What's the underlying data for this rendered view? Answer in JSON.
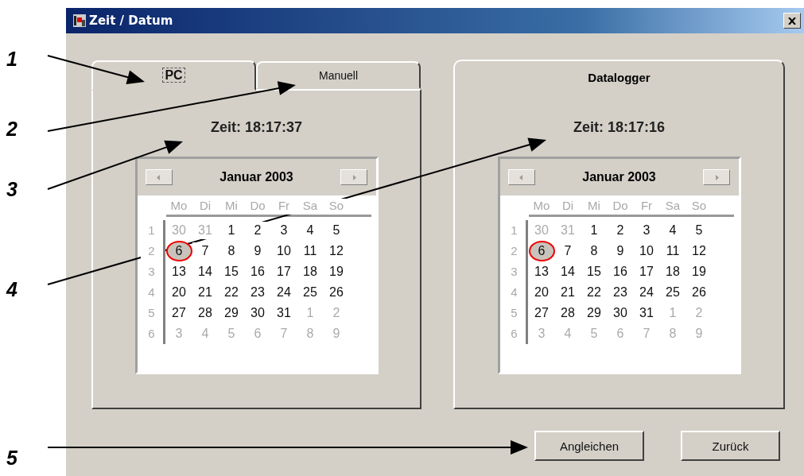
{
  "window": {
    "title": "Zeit / Datum"
  },
  "callouts": [
    {
      "number": "1"
    },
    {
      "number": "2"
    },
    {
      "number": "3"
    },
    {
      "number": "4"
    },
    {
      "number": "5"
    }
  ],
  "tabs": [
    {
      "label": "PC",
      "selected": true
    },
    {
      "label": "Manuell",
      "selected": false
    }
  ],
  "panels": [
    {
      "kind": "tabbed",
      "time": "Zeit: 18:17:37",
      "calendar": {
        "month": "Januar 2003",
        "weekdays": [
          "Mo",
          "Di",
          "Mi",
          "Do",
          "Fr",
          "Sa",
          "So"
        ],
        "weeks": [
          {
            "number": "1",
            "days": [
              {
                "day": "30",
                "muted": true,
                "selected": false
              },
              {
                "day": "31",
                "muted": true,
                "selected": false
              },
              {
                "day": "1",
                "muted": false,
                "selected": false
              },
              {
                "day": "2",
                "muted": false,
                "selected": false
              },
              {
                "day": "3",
                "muted": false,
                "selected": false
              },
              {
                "day": "4",
                "muted": false,
                "selected": false
              },
              {
                "day": "5",
                "muted": false,
                "selected": false
              }
            ]
          },
          {
            "number": "2",
            "days": [
              {
                "day": "6",
                "muted": false,
                "selected": true
              },
              {
                "day": "7",
                "muted": false,
                "selected": false
              },
              {
                "day": "8",
                "muted": false,
                "selected": false
              },
              {
                "day": "9",
                "muted": false,
                "selected": false
              },
              {
                "day": "10",
                "muted": false,
                "selected": false
              },
              {
                "day": "11",
                "muted": false,
                "selected": false
              },
              {
                "day": "12",
                "muted": false,
                "selected": false
              }
            ]
          },
          {
            "number": "3",
            "days": [
              {
                "day": "13",
                "muted": false,
                "selected": false
              },
              {
                "day": "14",
                "muted": false,
                "selected": false
              },
              {
                "day": "15",
                "muted": false,
                "selected": false
              },
              {
                "day": "16",
                "muted": false,
                "selected": false
              },
              {
                "day": "17",
                "muted": false,
                "selected": false
              },
              {
                "day": "18",
                "muted": false,
                "selected": false
              },
              {
                "day": "19",
                "muted": false,
                "selected": false
              }
            ]
          },
          {
            "number": "4",
            "days": [
              {
                "day": "20",
                "muted": false,
                "selected": false
              },
              {
                "day": "21",
                "muted": false,
                "selected": false
              },
              {
                "day": "22",
                "muted": false,
                "selected": false
              },
              {
                "day": "23",
                "muted": false,
                "selected": false
              },
              {
                "day": "24",
                "muted": false,
                "selected": false
              },
              {
                "day": "25",
                "muted": false,
                "selected": false
              },
              {
                "day": "26",
                "muted": false,
                "selected": false
              }
            ]
          },
          {
            "number": "5",
            "days": [
              {
                "day": "27",
                "muted": false,
                "selected": false
              },
              {
                "day": "28",
                "muted": false,
                "selected": false
              },
              {
                "day": "29",
                "muted": false,
                "selected": false
              },
              {
                "day": "30",
                "muted": false,
                "selected": false
              },
              {
                "day": "31",
                "muted": false,
                "selected": false
              },
              {
                "day": "1",
                "muted": true,
                "selected": false
              },
              {
                "day": "2",
                "muted": true,
                "selected": false
              }
            ]
          },
          {
            "number": "6",
            "days": [
              {
                "day": "3",
                "muted": true,
                "selected": false
              },
              {
                "day": "4",
                "muted": true,
                "selected": false
              },
              {
                "day": "5",
                "muted": true,
                "selected": false
              },
              {
                "day": "6",
                "muted": true,
                "selected": false
              },
              {
                "day": "7",
                "muted": true,
                "selected": false
              },
              {
                "day": "8",
                "muted": true,
                "selected": false
              },
              {
                "day": "9",
                "muted": true,
                "selected": false
              }
            ]
          }
        ]
      }
    },
    {
      "kind": "group",
      "title": "Datalogger",
      "time": "Zeit: 18:17:16",
      "calendar": {
        "month": "Januar 2003",
        "weekdays": [
          "Mo",
          "Di",
          "Mi",
          "Do",
          "Fr",
          "Sa",
          "So"
        ],
        "weeks": [
          {
            "number": "1",
            "days": [
              {
                "day": "30",
                "muted": true,
                "selected": false
              },
              {
                "day": "31",
                "muted": true,
                "selected": false
              },
              {
                "day": "1",
                "muted": false,
                "selected": false
              },
              {
                "day": "2",
                "muted": false,
                "selected": false
              },
              {
                "day": "3",
                "muted": false,
                "selected": false
              },
              {
                "day": "4",
                "muted": false,
                "selected": false
              },
              {
                "day": "5",
                "muted": false,
                "selected": false
              }
            ]
          },
          {
            "number": "2",
            "days": [
              {
                "day": "6",
                "muted": false,
                "selected": true
              },
              {
                "day": "7",
                "muted": false,
                "selected": false
              },
              {
                "day": "8",
                "muted": false,
                "selected": false
              },
              {
                "day": "9",
                "muted": false,
                "selected": false
              },
              {
                "day": "10",
                "muted": false,
                "selected": false
              },
              {
                "day": "11",
                "muted": false,
                "selected": false
              },
              {
                "day": "12",
                "muted": false,
                "selected": false
              }
            ]
          },
          {
            "number": "3",
            "days": [
              {
                "day": "13",
                "muted": false,
                "selected": false
              },
              {
                "day": "14",
                "muted": false,
                "selected": false
              },
              {
                "day": "15",
                "muted": false,
                "selected": false
              },
              {
                "day": "16",
                "muted": false,
                "selected": false
              },
              {
                "day": "17",
                "muted": false,
                "selected": false
              },
              {
                "day": "18",
                "muted": false,
                "selected": false
              },
              {
                "day": "19",
                "muted": false,
                "selected": false
              }
            ]
          },
          {
            "number": "4",
            "days": [
              {
                "day": "20",
                "muted": false,
                "selected": false
              },
              {
                "day": "21",
                "muted": false,
                "selected": false
              },
              {
                "day": "22",
                "muted": false,
                "selected": false
              },
              {
                "day": "23",
                "muted": false,
                "selected": false
              },
              {
                "day": "24",
                "muted": false,
                "selected": false
              },
              {
                "day": "25",
                "muted": false,
                "selected": false
              },
              {
                "day": "26",
                "muted": false,
                "selected": false
              }
            ]
          },
          {
            "number": "5",
            "days": [
              {
                "day": "27",
                "muted": false,
                "selected": false
              },
              {
                "day": "28",
                "muted": false,
                "selected": false
              },
              {
                "day": "29",
                "muted": false,
                "selected": false
              },
              {
                "day": "30",
                "muted": false,
                "selected": false
              },
              {
                "day": "31",
                "muted": false,
                "selected": false
              },
              {
                "day": "1",
                "muted": true,
                "selected": false
              },
              {
                "day": "2",
                "muted": true,
                "selected": false
              }
            ]
          },
          {
            "number": "6",
            "days": [
              {
                "day": "3",
                "muted": true,
                "selected": false
              },
              {
                "day": "4",
                "muted": true,
                "selected": false
              },
              {
                "day": "5",
                "muted": true,
                "selected": false
              },
              {
                "day": "6",
                "muted": true,
                "selected": false
              },
              {
                "day": "7",
                "muted": true,
                "selected": false
              },
              {
                "day": "8",
                "muted": true,
                "selected": false
              },
              {
                "day": "9",
                "muted": true,
                "selected": false
              }
            ]
          }
        ]
      }
    }
  ],
  "buttons": [
    "Angleichen",
    "Zurück"
  ]
}
